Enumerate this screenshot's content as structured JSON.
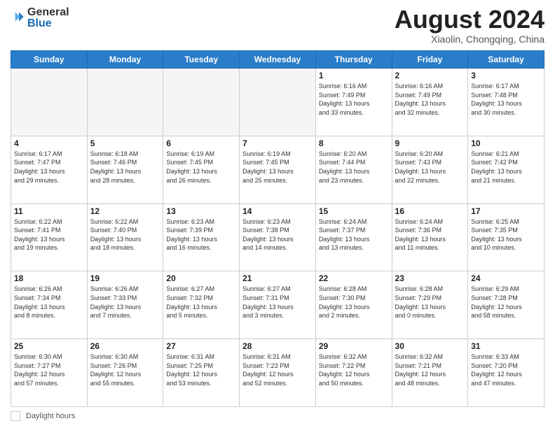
{
  "header": {
    "logo_general": "General",
    "logo_blue": "Blue",
    "title": "August 2024",
    "location": "Xiaolin, Chongqing, China"
  },
  "days_of_week": [
    "Sunday",
    "Monday",
    "Tuesday",
    "Wednesday",
    "Thursday",
    "Friday",
    "Saturday"
  ],
  "footer": {
    "daylight_label": "Daylight hours"
  },
  "weeks": [
    [
      {
        "day": "",
        "info": ""
      },
      {
        "day": "",
        "info": ""
      },
      {
        "day": "",
        "info": ""
      },
      {
        "day": "",
        "info": ""
      },
      {
        "day": "1",
        "info": "Sunrise: 6:16 AM\nSunset: 7:49 PM\nDaylight: 13 hours\nand 33 minutes."
      },
      {
        "day": "2",
        "info": "Sunrise: 6:16 AM\nSunset: 7:49 PM\nDaylight: 13 hours\nand 32 minutes."
      },
      {
        "day": "3",
        "info": "Sunrise: 6:17 AM\nSunset: 7:48 PM\nDaylight: 13 hours\nand 30 minutes."
      }
    ],
    [
      {
        "day": "4",
        "info": "Sunrise: 6:17 AM\nSunset: 7:47 PM\nDaylight: 13 hours\nand 29 minutes."
      },
      {
        "day": "5",
        "info": "Sunrise: 6:18 AM\nSunset: 7:46 PM\nDaylight: 13 hours\nand 28 minutes."
      },
      {
        "day": "6",
        "info": "Sunrise: 6:19 AM\nSunset: 7:45 PM\nDaylight: 13 hours\nand 26 minutes."
      },
      {
        "day": "7",
        "info": "Sunrise: 6:19 AM\nSunset: 7:45 PM\nDaylight: 13 hours\nand 25 minutes."
      },
      {
        "day": "8",
        "info": "Sunrise: 6:20 AM\nSunset: 7:44 PM\nDaylight: 13 hours\nand 23 minutes."
      },
      {
        "day": "9",
        "info": "Sunrise: 6:20 AM\nSunset: 7:43 PM\nDaylight: 13 hours\nand 22 minutes."
      },
      {
        "day": "10",
        "info": "Sunrise: 6:21 AM\nSunset: 7:42 PM\nDaylight: 13 hours\nand 21 minutes."
      }
    ],
    [
      {
        "day": "11",
        "info": "Sunrise: 6:22 AM\nSunset: 7:41 PM\nDaylight: 13 hours\nand 19 minutes."
      },
      {
        "day": "12",
        "info": "Sunrise: 6:22 AM\nSunset: 7:40 PM\nDaylight: 13 hours\nand 18 minutes."
      },
      {
        "day": "13",
        "info": "Sunrise: 6:23 AM\nSunset: 7:39 PM\nDaylight: 13 hours\nand 16 minutes."
      },
      {
        "day": "14",
        "info": "Sunrise: 6:23 AM\nSunset: 7:38 PM\nDaylight: 13 hours\nand 14 minutes."
      },
      {
        "day": "15",
        "info": "Sunrise: 6:24 AM\nSunset: 7:37 PM\nDaylight: 13 hours\nand 13 minutes."
      },
      {
        "day": "16",
        "info": "Sunrise: 6:24 AM\nSunset: 7:36 PM\nDaylight: 13 hours\nand 11 minutes."
      },
      {
        "day": "17",
        "info": "Sunrise: 6:25 AM\nSunset: 7:35 PM\nDaylight: 13 hours\nand 10 minutes."
      }
    ],
    [
      {
        "day": "18",
        "info": "Sunrise: 6:26 AM\nSunset: 7:34 PM\nDaylight: 13 hours\nand 8 minutes."
      },
      {
        "day": "19",
        "info": "Sunrise: 6:26 AM\nSunset: 7:33 PM\nDaylight: 13 hours\nand 7 minutes."
      },
      {
        "day": "20",
        "info": "Sunrise: 6:27 AM\nSunset: 7:32 PM\nDaylight: 13 hours\nand 5 minutes."
      },
      {
        "day": "21",
        "info": "Sunrise: 6:27 AM\nSunset: 7:31 PM\nDaylight: 13 hours\nand 3 minutes."
      },
      {
        "day": "22",
        "info": "Sunrise: 6:28 AM\nSunset: 7:30 PM\nDaylight: 13 hours\nand 2 minutes."
      },
      {
        "day": "23",
        "info": "Sunrise: 6:28 AM\nSunset: 7:29 PM\nDaylight: 13 hours\nand 0 minutes."
      },
      {
        "day": "24",
        "info": "Sunrise: 6:29 AM\nSunset: 7:28 PM\nDaylight: 12 hours\nand 58 minutes."
      }
    ],
    [
      {
        "day": "25",
        "info": "Sunrise: 6:30 AM\nSunset: 7:27 PM\nDaylight: 12 hours\nand 57 minutes."
      },
      {
        "day": "26",
        "info": "Sunrise: 6:30 AM\nSunset: 7:26 PM\nDaylight: 12 hours\nand 55 minutes."
      },
      {
        "day": "27",
        "info": "Sunrise: 6:31 AM\nSunset: 7:25 PM\nDaylight: 12 hours\nand 53 minutes."
      },
      {
        "day": "28",
        "info": "Sunrise: 6:31 AM\nSunset: 7:23 PM\nDaylight: 12 hours\nand 52 minutes."
      },
      {
        "day": "29",
        "info": "Sunrise: 6:32 AM\nSunset: 7:22 PM\nDaylight: 12 hours\nand 50 minutes."
      },
      {
        "day": "30",
        "info": "Sunrise: 6:32 AM\nSunset: 7:21 PM\nDaylight: 12 hours\nand 48 minutes."
      },
      {
        "day": "31",
        "info": "Sunrise: 6:33 AM\nSunset: 7:20 PM\nDaylight: 12 hours\nand 47 minutes."
      }
    ]
  ]
}
